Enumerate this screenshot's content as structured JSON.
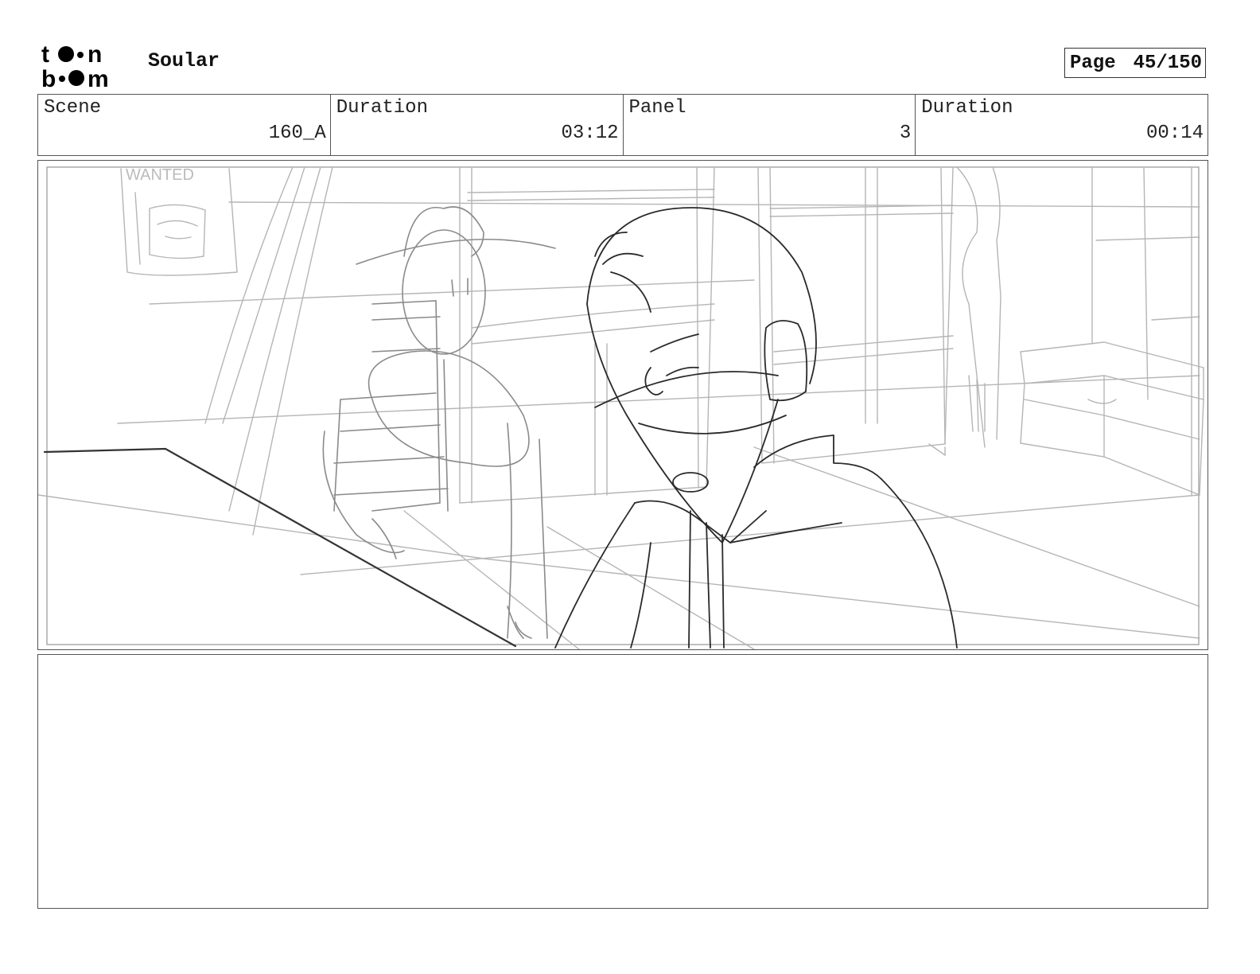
{
  "header": {
    "logo_text_top": "toon",
    "logo_text_bottom": "boom",
    "project_title": "Soular",
    "page_label": "Page",
    "page_number": "45/150"
  },
  "info": {
    "scene_label": "Scene",
    "scene_value": "160_A",
    "scene_duration_label": "Duration",
    "scene_duration_value": "03:12",
    "panel_label": "Panel",
    "panel_value": "3",
    "panel_duration_label": "Duration",
    "panel_duration_value": "00:14"
  },
  "panel": {
    "poster_text": "WANTED"
  },
  "notes": {
    "text": ""
  }
}
